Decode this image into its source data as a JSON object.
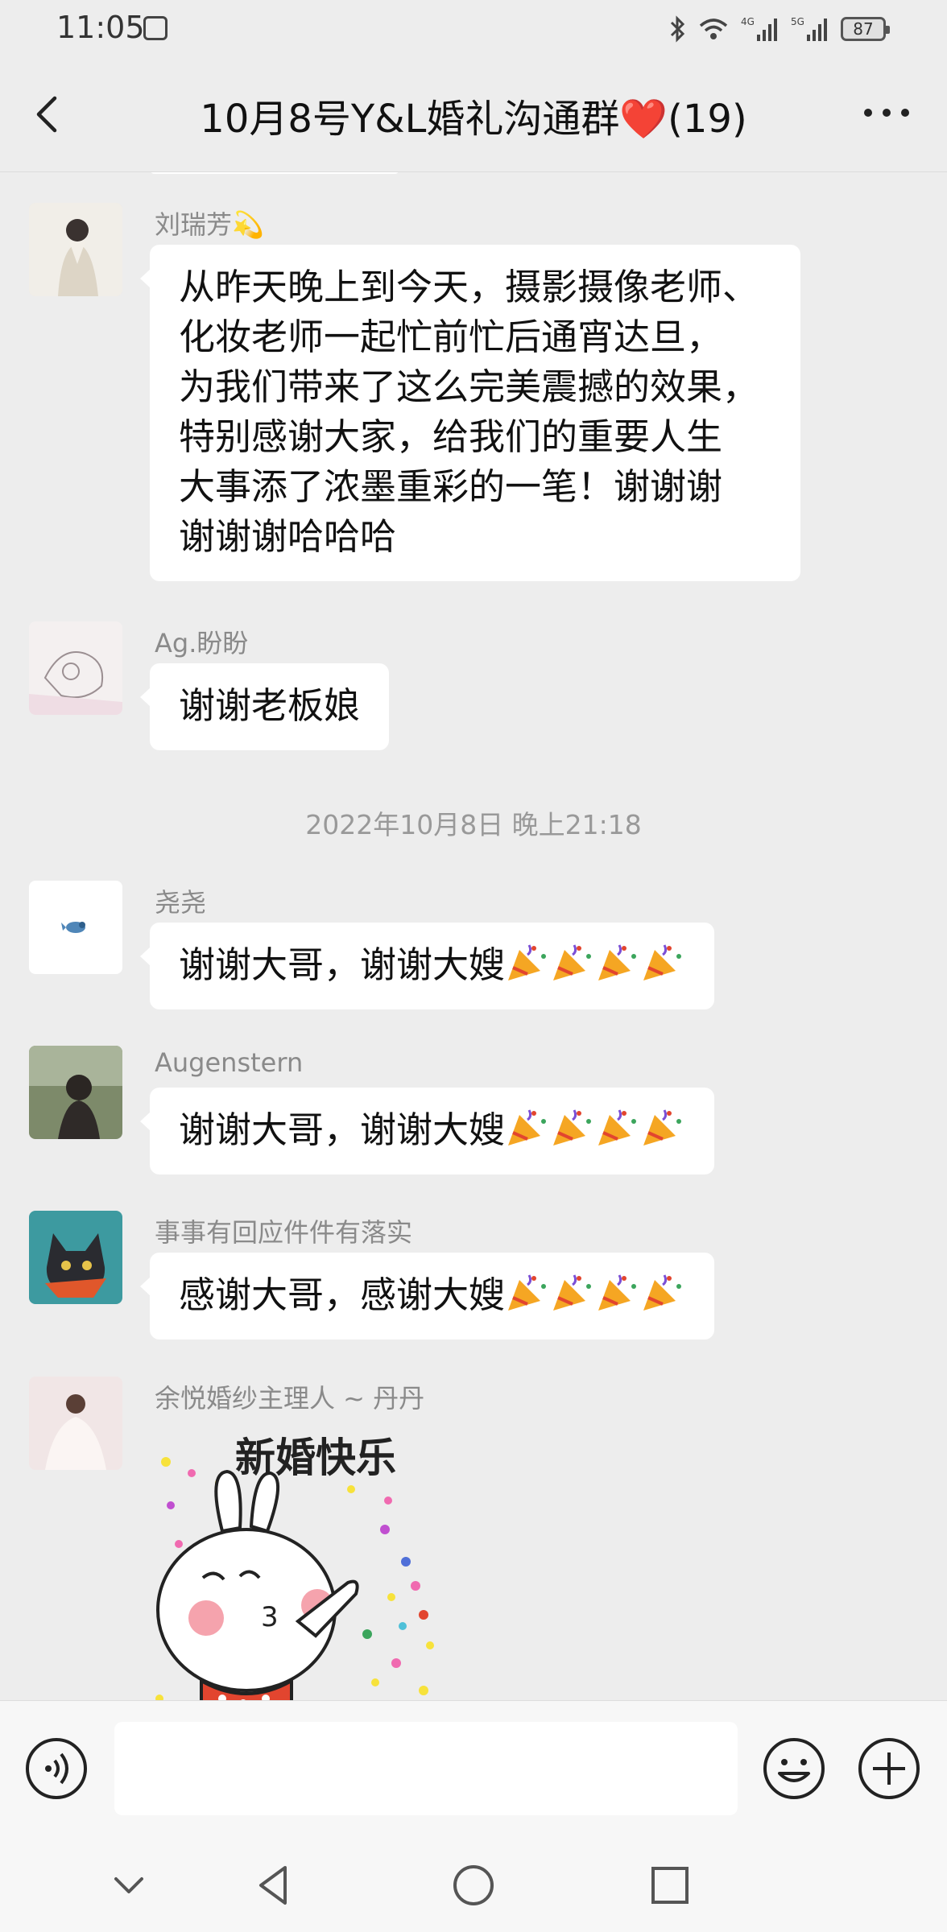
{
  "status_bar": {
    "time": "11:05",
    "battery": "87",
    "net_4g": "4G",
    "net_5g": "5G"
  },
  "header": {
    "title": "10月8号Y&L婚礼沟通群❤️(19)"
  },
  "messages": [
    {
      "sender": "刘瑞芳💫",
      "lines": [
        "从昨天晚上到今天，摄影摄像老师、",
        "化妆老师一起忙前忙后通宵达旦，",
        "为我们带来了这么完美震撼的效果，",
        "特别感谢大家，给我们的重要人生",
        "大事添了浓墨重彩的一笔！谢谢谢",
        "谢谢谢哈哈哈"
      ]
    },
    {
      "sender": "Ag.盼盼",
      "text": "谢谢老板娘"
    },
    {
      "timestamp": "2022年10月8日 晚上21:18"
    },
    {
      "sender": "尧尧",
      "text": "谢谢大哥，谢谢大嫂"
    },
    {
      "sender": "Augenstern",
      "text": "谢谢大哥，谢谢大嫂"
    },
    {
      "sender": "事事有回应件件有落实",
      "text": "感谢大哥，感谢大嫂"
    },
    {
      "sender": "余悦婚纱主理人 ~ 丹丹",
      "sticker_text": "新婚快乐"
    }
  ],
  "icons": {
    "back": "chevron-left-icon",
    "more": "more-dots-icon",
    "voice": "voice-icon",
    "emoji": "emoji-icon",
    "plus": "plus-icon",
    "party": "party-popper-icon"
  },
  "colors": {
    "background": "#ededed",
    "bubble": "#ffffff",
    "heart": "#e53935"
  }
}
